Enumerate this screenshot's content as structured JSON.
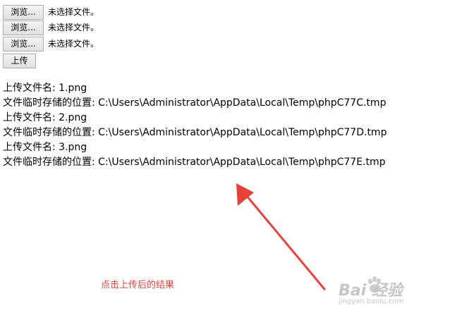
{
  "form": {
    "file_inputs": [
      {
        "button_label": "浏览...",
        "status": "未选择文件。"
      },
      {
        "button_label": "浏览...",
        "status": "未选择文件。"
      },
      {
        "button_label": "浏览...",
        "status": "未选择文件。"
      }
    ],
    "upload_label": "上传"
  },
  "results": [
    "上传文件名: 1.png",
    "文件临时存储的位置: C:\\Users\\Administrator\\AppData\\Local\\Temp\\phpC77C.tmp",
    "上传文件名: 2.png",
    "文件临时存储的位置: C:\\Users\\Administrator\\AppData\\Local\\Temp\\phpC77D.tmp",
    "上传文件名: 3.png",
    "文件临时存储的位置: C:\\Users\\Administrator\\AppData\\Local\\Temp\\phpC77E.tmp"
  ],
  "annotation": {
    "caption": "点击上传后的结果",
    "color": "#e8413a"
  },
  "watermark": {
    "logo": "Bai 经验",
    "sub": "jingyan.baidu.com"
  }
}
